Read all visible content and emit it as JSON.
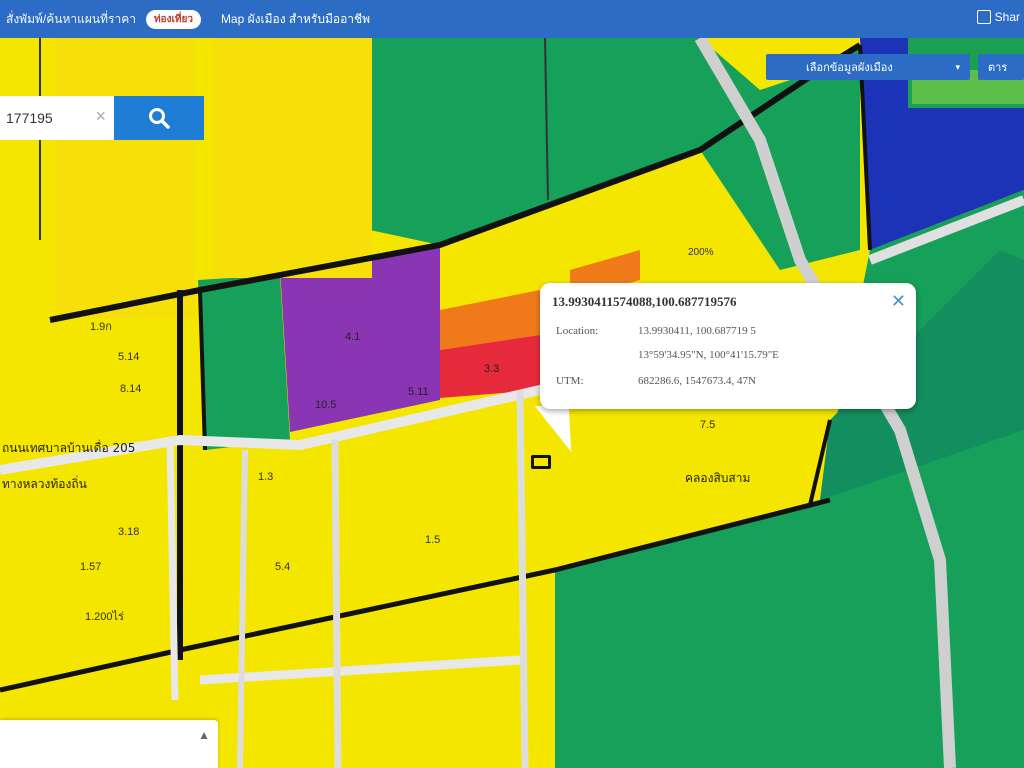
{
  "topbar": {
    "left_text": "สั่งพัมพ์/ค้นหาแผนที่ราคา",
    "badge_text": "ท่องเที่ยว",
    "center_text": "Map ผังเมือง สำหรับมืออาชีพ",
    "share_label": "Shar"
  },
  "controls": {
    "layer_dropdown_label": "เลือกข้อมูลผังเมือง",
    "right_button_label": "ตาร"
  },
  "search": {
    "value": "177195",
    "clear_glyph": "×"
  },
  "popup": {
    "title": "13.9930411574088,100.687719576",
    "close_glyph": "✕",
    "rows": [
      {
        "label": "Location:",
        "value": "13.9930411, 100.687719 5"
      },
      {
        "label": "",
        "value": "13°59'34.95\"N, 100°41'15.79\"E"
      },
      {
        "label": "UTM:",
        "value": "682286.6, 1547673.4, 47N"
      }
    ]
  },
  "map_labels": {
    "road_left": "ถนนเทศบาลบ้านเดื่อ 205",
    "road_left2": "ทางหลวงท้องถิ่น",
    "label_right": "คลองสิบสาม",
    "zone_codes": [
      "5.14",
      "8.14",
      "1.9ก",
      "4.1",
      "10.5",
      "5.11",
      "3.3",
      "1.5",
      "1.57",
      "1.200ไร่",
      "3.18",
      "7.5",
      "5.4",
      "1.3",
      "200%"
    ]
  },
  "colors": {
    "topbar": "#2d6cc4",
    "zone_residential_low": "#f5e600",
    "zone_green": "#16a05a",
    "zone_purple": "#8a36b4",
    "zone_orange": "#f07a1a",
    "zone_red": "#e62a3c",
    "zone_water": "#1c33b8"
  }
}
